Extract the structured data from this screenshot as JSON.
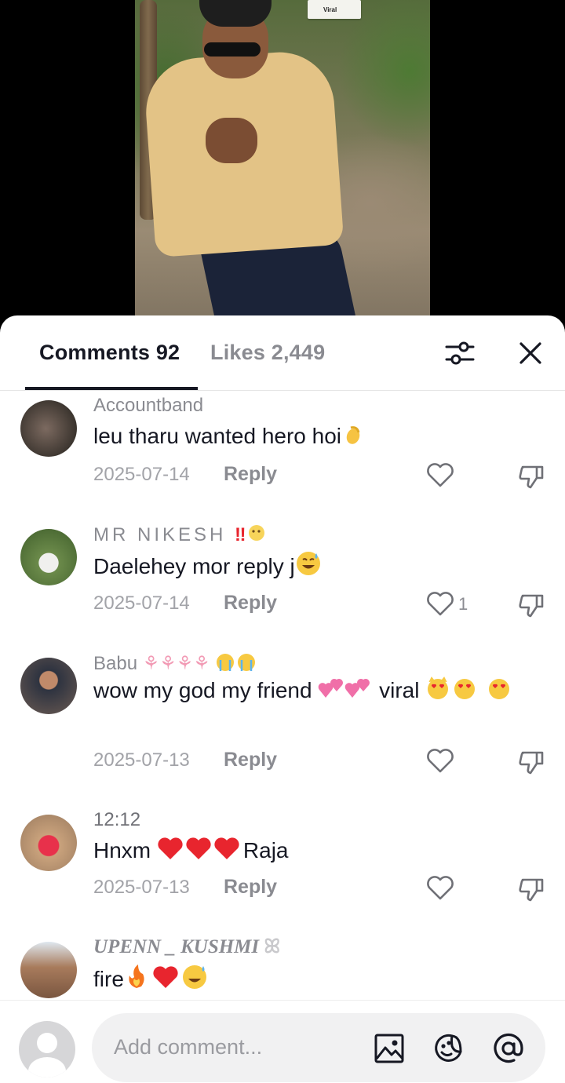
{
  "video": {
    "sticker_text": "Viral"
  },
  "tabs": {
    "comments": "Comments 92",
    "likes": "Likes 2,449"
  },
  "comments": [
    {
      "username": "Accountband",
      "text": "leu tharu wanted hero hoi",
      "date": "2025-07-14",
      "reply": "Reply",
      "likes": ""
    },
    {
      "username": "MR NIKESH",
      "text": "Daelehey mor reply j",
      "date": "2025-07-14",
      "reply": "Reply",
      "likes": "1"
    },
    {
      "username": "Babu",
      "text": "wow my god my friend",
      "text_b": "viral",
      "date": "2025-07-13",
      "reply": "Reply",
      "likes": ""
    },
    {
      "username": "12:12",
      "text": "Hnxm",
      "text_b": "Raja",
      "date": "2025-07-13",
      "reply": "Reply",
      "likes": ""
    },
    {
      "username": "UPENN _ KUSHMI",
      "text": "fire",
      "date": "",
      "reply": "",
      "likes": ""
    }
  ],
  "input": {
    "placeholder": "Add comment..."
  },
  "icons": [
    "filter-icon",
    "close-icon",
    "heart-icon",
    "dislike-icon",
    "image-icon",
    "emoji-icon",
    "mention-icon"
  ],
  "colors": {
    "text": "#161823",
    "muted": "#8a8b91",
    "heart_red": "#e8252e",
    "input_bg": "#f1f1f2"
  }
}
